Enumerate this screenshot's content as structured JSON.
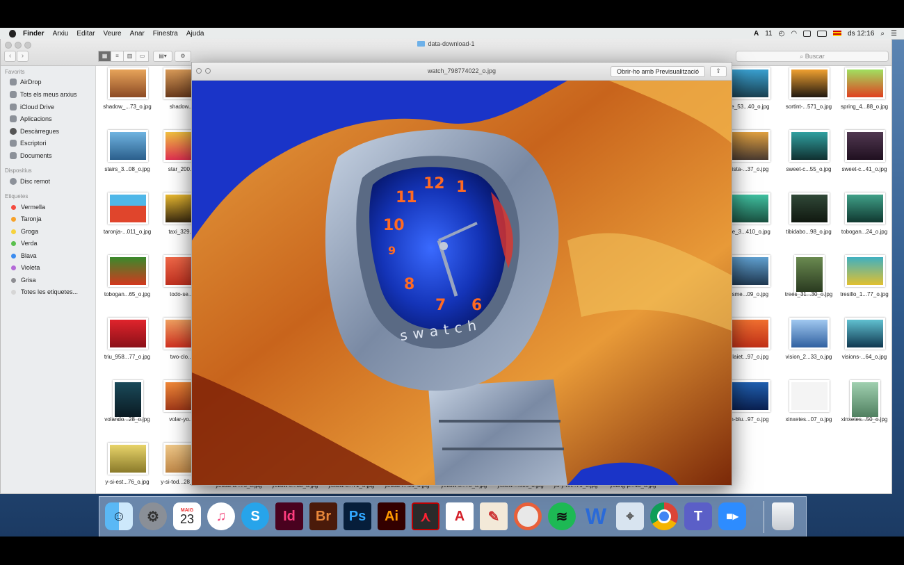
{
  "menubar": {
    "app_name": "Finder",
    "items": [
      "Arxiu",
      "Editar",
      "Veure",
      "Anar",
      "Finestra",
      "Ajuda"
    ],
    "status_number": "11",
    "clock": "ds 12:16"
  },
  "finder": {
    "title": "data-download-1",
    "search_placeholder": "Buscar",
    "sidebar": {
      "favorites_header": "Favorits",
      "favorites": [
        "AirDrop",
        "Tots els meus arxius",
        "iCloud Drive",
        "Aplicacions",
        "Descàrregues",
        "Escriptori",
        "Documents"
      ],
      "devices_header": "Dispositius",
      "devices": [
        "Disc remot"
      ],
      "tags_header": "Etiquetes",
      "tags": [
        {
          "label": "Vermella",
          "color": "#f44c40"
        },
        {
          "label": "Taronja",
          "color": "#f7a22a"
        },
        {
          "label": "Groga",
          "color": "#f6d23d"
        },
        {
          "label": "Verda",
          "color": "#5ac04e"
        },
        {
          "label": "Blava",
          "color": "#3b8cf0"
        },
        {
          "label": "Violeta",
          "color": "#b46ad8"
        },
        {
          "label": "Grisa",
          "color": "#8e8e93"
        }
      ],
      "all_tags": "Totes les etiquetes..."
    },
    "files": {
      "left_col1": [
        "shadow_...73_o.jpg",
        "stairs_3...08_o.jpg",
        "taronja-...011_o.jpg",
        "tobogan...65_o.jpg",
        "triu_958...77_o.jpg",
        "volando...28_o.jpg",
        "y-si-est...76_o.jpg"
      ],
      "left_col2": [
        "shadow...7",
        "star_200...7",
        "taxi_329...3",
        "todo-se...6",
        "two-clo...6",
        "volar-yo...3",
        "y-si-tod...28_o.jpg"
      ],
      "right_col1": [
        "le_53...40_o.jpg",
        "fista-...37_o.jpg",
        "ne_3...410_o.jpg",
        "isme...09_o.jpg",
        "-laiet...97_o.jpg",
        "n-blu...97_o.jpg"
      ],
      "right_col2": [
        "sortint-...571_o.jpg",
        "sweet-c...55_o.jpg",
        "tibidabo...98_o.jpg",
        "trees_31...30_o.jpg",
        "vision_2...33_o.jpg",
        "xinxetes...07_o.jpg"
      ],
      "right_col3": [
        "spring_4...88_o.jpg",
        "sweet-c...41_o.jpg",
        "tobogan...24_o.jpg",
        "tresillo_1...77_o.jpg",
        "visions-...64_o.jpg",
        "xinxetes...50_o.jpg"
      ],
      "bottom_row": [
        "yellow-b...75_o.jpg",
        "yellow-c...08_o.jpg",
        "yellow-c...71_o.jpg",
        "yellow-r...96_o.jpg",
        "yellow-s...70_o.jpg",
        "yellow-...515_o.jpg",
        "yo-y-mi...79_o.jpg",
        "young-p...46_o.jpg"
      ]
    }
  },
  "preview": {
    "filename": "watch_798774022_o.jpg",
    "open_button": "Obrir-ho amb Previsualització",
    "watch_numerals": [
      "12",
      "1",
      "11",
      "10",
      "9",
      "8",
      "7",
      "6"
    ],
    "watch_bezel_text": "swatch"
  },
  "dock": {
    "calendar_day": "23",
    "calendar_month": "MAIG",
    "apps": [
      "Finder",
      "System Preferences",
      "Calendar",
      "iTunes",
      "Skype",
      "InDesign",
      "Bridge",
      "Photoshop",
      "Illustrator",
      "Acrobat",
      "AutoCAD",
      "Sketch",
      "Screenium",
      "Spotify",
      "Word",
      "Preview",
      "Chrome",
      "Teams",
      "Zoom",
      "Trash"
    ],
    "labels": {
      "id": "Id",
      "br": "Br",
      "ps": "Ps",
      "ai": "Ai",
      "s": "S",
      "w": "W",
      "t": "T"
    }
  }
}
